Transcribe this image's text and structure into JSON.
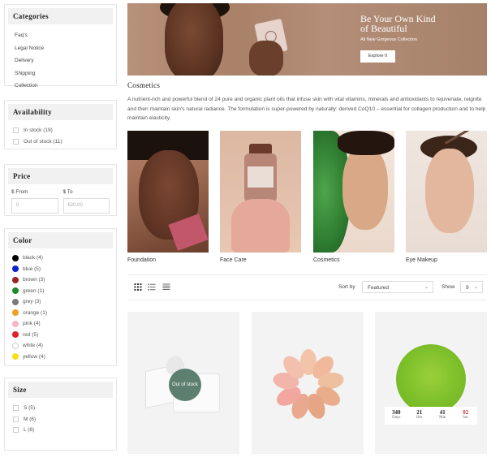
{
  "sidebar": {
    "categories": {
      "title": "Categories",
      "items": [
        "Faq's",
        "Legal Notice",
        "Delivery",
        "Shipping",
        "Collection"
      ]
    },
    "availability": {
      "title": "Availability",
      "items": [
        "In stock (19)",
        "Out of stock (11)"
      ]
    },
    "price": {
      "title": "Price",
      "from_label": "$ From",
      "to_label": "$ To",
      "from_placeholder": "0",
      "to_placeholder": "620.00"
    },
    "color": {
      "title": "Color",
      "items": [
        {
          "label": "black (4)",
          "hex": "#000000"
        },
        {
          "label": "blue (5)",
          "hex": "#0c1fd1"
        },
        {
          "label": "brown (3)",
          "hex": "#9b2424"
        },
        {
          "label": "green (1)",
          "hex": "#1f8a2b"
        },
        {
          "label": "grey (3)",
          "hex": "#7a7a7a"
        },
        {
          "label": "orange (1)",
          "hex": "#f0a020"
        },
        {
          "label": "pink (4)",
          "hex": "#f7b6c2"
        },
        {
          "label": "red (5)",
          "hex": "#e0202a"
        },
        {
          "label": "white (4)",
          "hex": "#ffffff"
        },
        {
          "label": "yellow (4)",
          "hex": "#f6e21a"
        }
      ]
    },
    "size": {
      "title": "Size",
      "items": [
        "S (5)",
        "M (6)",
        "L (8)"
      ]
    }
  },
  "hero": {
    "title_line1": "Be Your Own Kind",
    "title_line2": "of  Beautiful",
    "subtitle": "All New Gorgeous Collection",
    "button": "Explore It"
  },
  "section": {
    "title": "Cosmetics",
    "description": "A nutrient-rich and powerful blend of 24 pure and organic plant oils that infuse skin with vital vitamins, minerals and antioxidants to rejuvenate, reignite and then maintain skin's natural radiance. The formulation is super-powered by naturally: derived CoQ10 – essential for collagen production and to help maintain elasticity."
  },
  "subcategories": [
    "Foundation",
    "Face Care",
    "Cosmetics",
    "Eye Makeup"
  ],
  "toolbar": {
    "sort_label": "Sort by",
    "sort_value": "Featured",
    "show_label": "Show",
    "show_value": "9"
  },
  "products": {
    "badge": "Out of stock",
    "countdown": [
      {
        "num": "340",
        "label": "Days"
      },
      {
        "num": "21",
        "label": "Hrs"
      },
      {
        "num": "41",
        "label": "Min"
      },
      {
        "num": "02",
        "label": "Sec"
      }
    ]
  },
  "icons": [
    "grid-view-icon",
    "list-view-icon",
    "compact-list-icon",
    "chevron-down-icon"
  ]
}
